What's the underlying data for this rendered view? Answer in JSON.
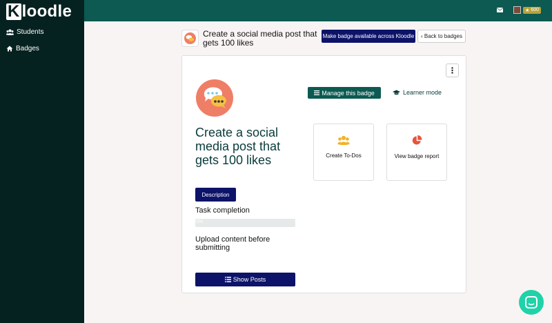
{
  "app": {
    "logo_initial": "K",
    "logo_rest": "loodle"
  },
  "sidebar": {
    "items": [
      {
        "label": "Students",
        "icon": "users-icon"
      },
      {
        "label": "Badges",
        "icon": "home-icon"
      }
    ]
  },
  "topbar": {
    "points": "600"
  },
  "header": {
    "title": "Create a social media post that gets 100 likes",
    "make_available_label": "Make badge available across Kloodle",
    "back_label": "‹ Back to badges"
  },
  "card": {
    "badge_title": "Create a social media post that gets 100 likes",
    "manage_label": "Manage this badge",
    "learner_label": "Learner mode",
    "tiles": [
      {
        "label": "Create To-Dos",
        "icon": "users-icon",
        "color": "#f0b429"
      },
      {
        "label": "View badge report",
        "icon": "pie-chart-icon",
        "color": "#e8543a"
      }
    ],
    "description_label": "Description",
    "task_completion_label": "Task completion",
    "progress_text": "0%",
    "progress_value": 0,
    "upload_text": "Upload content before submitting",
    "show_posts_label": "Show Posts"
  },
  "colors": {
    "sidebar_bg": "#062220",
    "topbar_bg": "#0c5a51",
    "primary_button": "#0d1368",
    "accent_teal": "#0c5a51",
    "badge_bg": "#ef7e66",
    "chat_bg": "#1fd2a8"
  }
}
